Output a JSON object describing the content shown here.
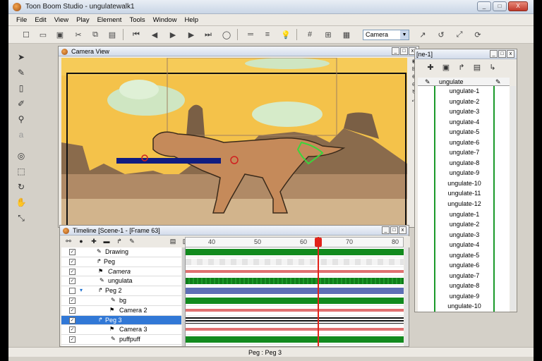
{
  "window": {
    "title": "Toon Boom Studio - ungulatewalk1",
    "controls": [
      "_",
      "□",
      "X"
    ]
  },
  "menu": [
    "File",
    "Edit",
    "View",
    "Play",
    "Element",
    "Tools",
    "Window",
    "Help"
  ],
  "toolbar": {
    "camera_select": "Camera",
    "icons": [
      "new-icon",
      "open-icon",
      "save-icon",
      "cut-icon",
      "copy-icon",
      "paste-icon",
      "first-frame-icon",
      "prev-frame-icon",
      "play-icon",
      "next-frame-icon",
      "loop-icon",
      "onion-skin-icon",
      "onion-skin-icon-2",
      "light-table-icon",
      "grid-icon",
      "field-grid-icon",
      "safe-area-icon",
      "camera-tool-1-icon",
      "camera-tool-2-icon",
      "camera-tool-3-icon",
      "camera-tool-4-icon"
    ]
  },
  "left_tools": [
    "select-icon",
    "brush-icon",
    "paint-bucket-icon",
    "pencil-icon",
    "zoom-icon",
    "text-icon",
    "contour-icon",
    "crop-icon",
    "rotate-icon",
    "hand-icon",
    "reposition-icon"
  ],
  "camera_view": {
    "title": "Camera View"
  },
  "timeline": {
    "title": "Timeline [Scene-1 - [Frame 63]",
    "ruler": [
      "40",
      "50",
      "60",
      "70",
      "80"
    ],
    "layers": [
      {
        "name": "Drawing",
        "checked": true,
        "selected": false,
        "icon": "drawing-icon"
      },
      {
        "name": "Peg",
        "checked": true,
        "selected": false,
        "icon": "peg-icon"
      },
      {
        "name": "Camera",
        "checked": true,
        "selected": false,
        "icon": "camera-icon"
      },
      {
        "name": "ungulata",
        "checked": true,
        "selected": false,
        "icon": "drawing-icon"
      },
      {
        "name": "Peg 2",
        "checked": false,
        "selected": false,
        "icon": "peg-icon"
      },
      {
        "name": "bg",
        "checked": true,
        "selected": false,
        "icon": "drawing-icon"
      },
      {
        "name": "Camera 2",
        "checked": true,
        "selected": false,
        "icon": "camera-icon"
      },
      {
        "name": "Peg 3",
        "checked": true,
        "selected": true,
        "icon": "peg-icon"
      },
      {
        "name": "Camera 3",
        "checked": true,
        "selected": false,
        "icon": "camera-icon"
      },
      {
        "name": "puffpuff",
        "checked": true,
        "selected": false,
        "icon": "drawing-icon"
      }
    ],
    "current_frame": 63
  },
  "exposure_sheet": {
    "title": "[ne-1]",
    "column_header": "ungulate",
    "cells": [
      "ungulate-1",
      "ungulate-2",
      "ungulate-3",
      "ungulate-4",
      "ungulate-5",
      "ungulate-6",
      "ungulate-7",
      "ungulate-8",
      "ungulate-9",
      "ungulate-10",
      "ungulate-11",
      "ungulate-12",
      "ungulate-1",
      "ungulate-2",
      "ungulate-3",
      "ungulate-4",
      "ungulate-5",
      "ungulate-6",
      "ungulate-7",
      "ungulate-8",
      "ungulate-9",
      "ungulate-10"
    ]
  },
  "status": {
    "text": "Peg : Peg 3"
  },
  "colors": {
    "sky": "#f4c24a",
    "green_track": "#128a1e",
    "selection": "#3178d6",
    "playhead": "#e2231a"
  }
}
